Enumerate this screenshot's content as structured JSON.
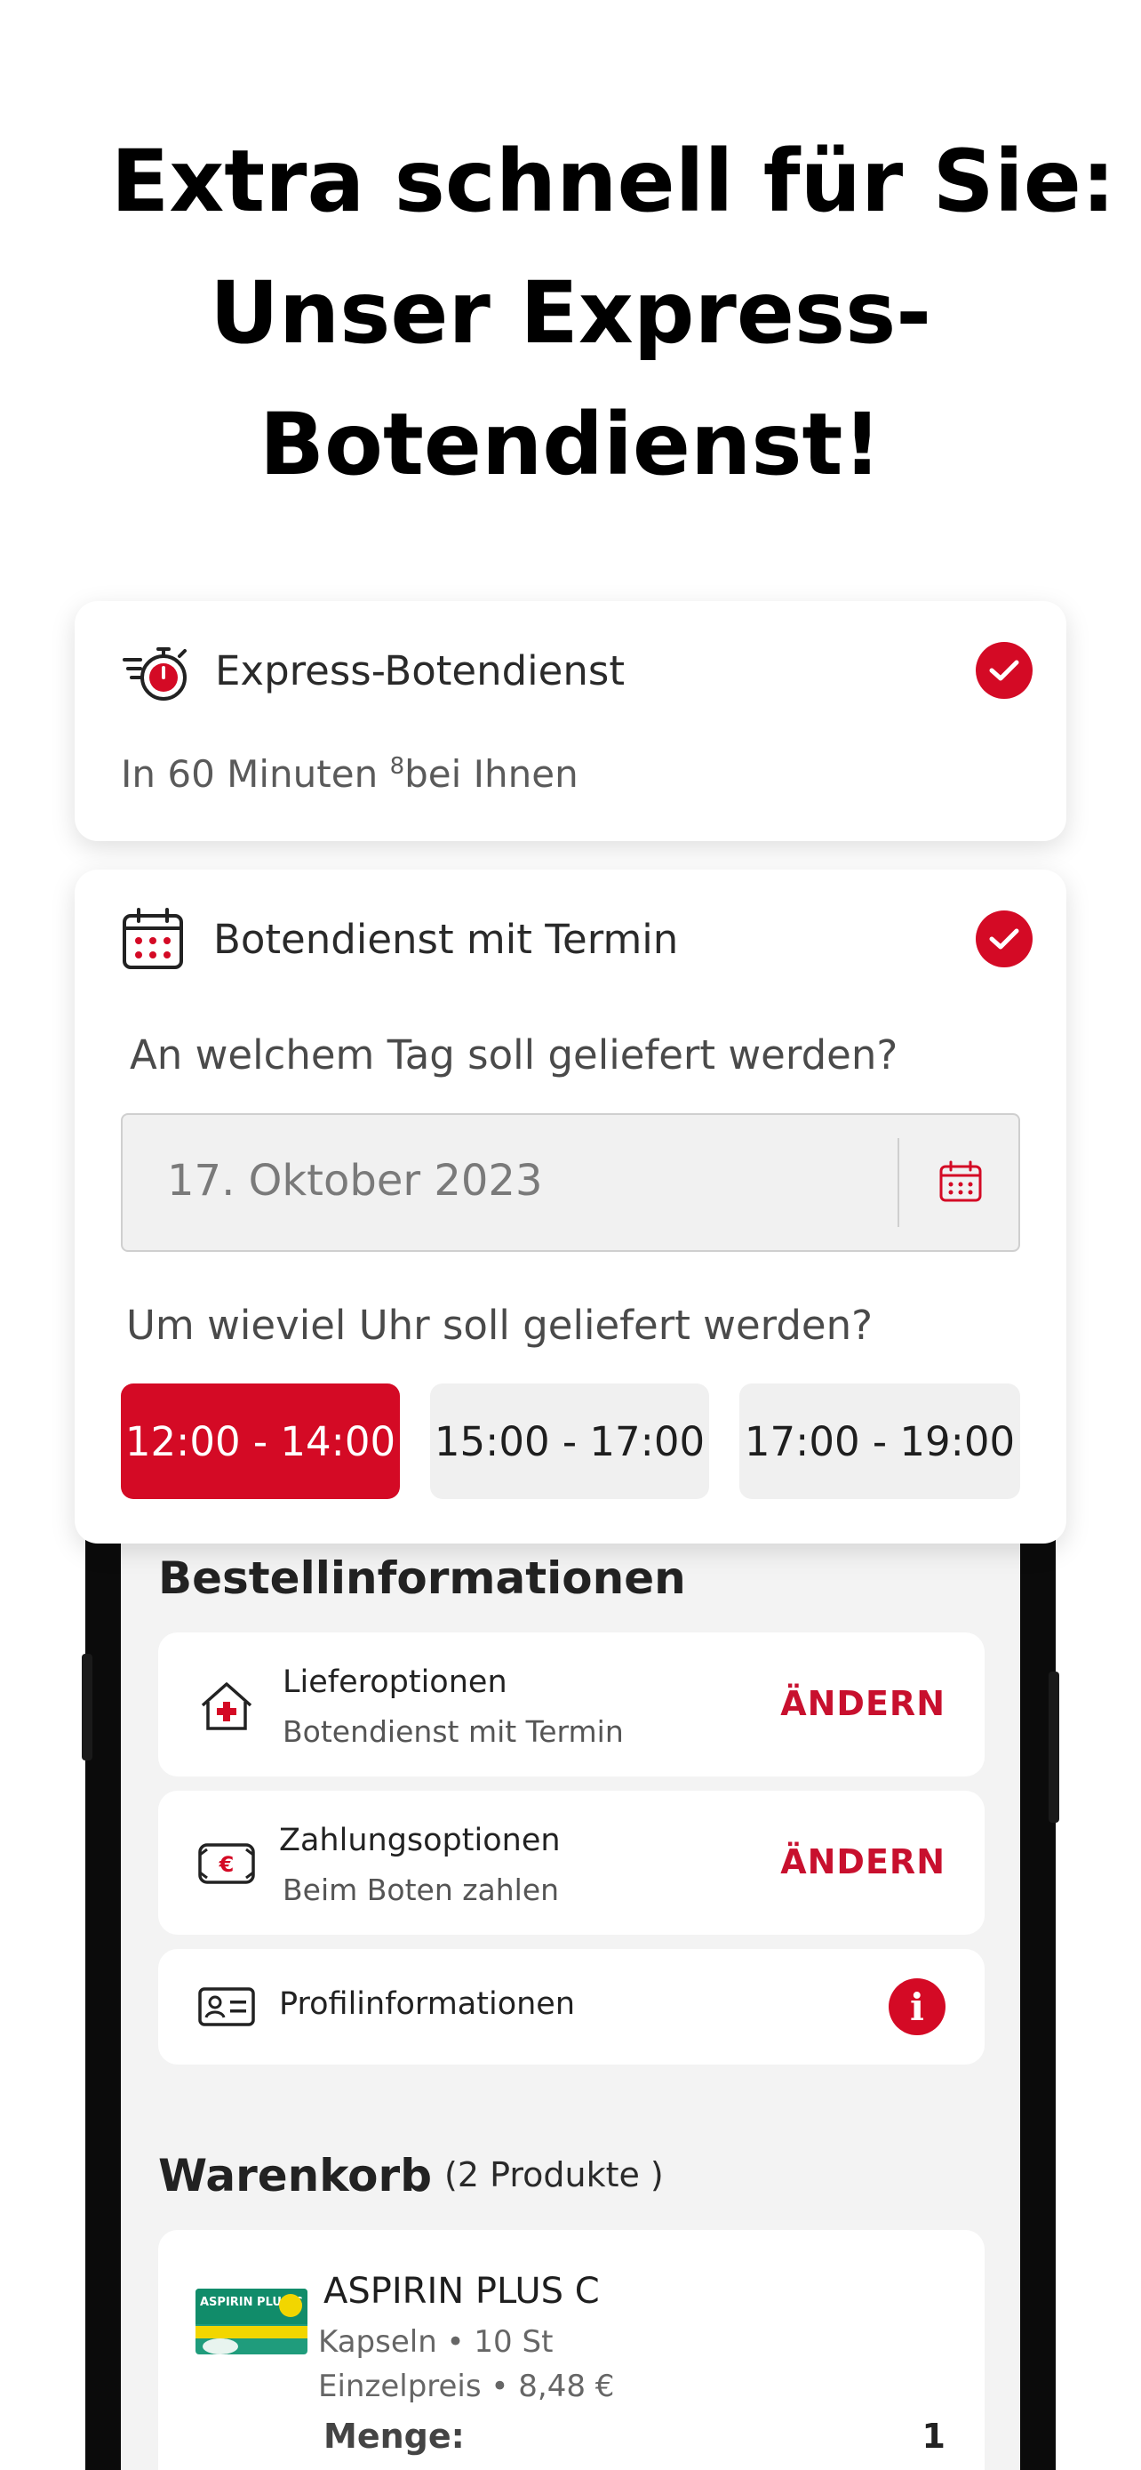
{
  "headline": {
    "line1": "Extra schnell für Sie:",
    "line2": "Unser Express-",
    "line3": "Botendienst!"
  },
  "express_card": {
    "title": "Express-Botendienst",
    "subtitle_before": "In 60 Minuten ",
    "superscript": "8",
    "subtitle_after": "bei Ihnen",
    "selected": true,
    "icon": "stopwatch-icon"
  },
  "appointment_card": {
    "title": "Botendienst mit Termin",
    "selected": true,
    "icon": "calendar-icon",
    "day_question": "An welchem Tag soll geliefert werden?",
    "date_value": "17. Oktober 2023",
    "time_question": "Um wieviel Uhr soll geliefert werden?",
    "slots": [
      {
        "label": "12:00 - 14:00",
        "active": true
      },
      {
        "label": "15:00 - 17:00",
        "active": false
      },
      {
        "label": "17:00 - 19:00",
        "active": false
      }
    ]
  },
  "order_info": {
    "title": "Bestellinformationen",
    "delivery": {
      "label": "Lieferoptionen",
      "value": "Botendienst mit Termin",
      "action": "ÄNDERN",
      "icon": "house-medical-icon"
    },
    "payment": {
      "label": "Zahlungsoptionen",
      "value": "Beim Boten zahlen",
      "action": "ÄNDERN",
      "icon": "euro-cash-icon"
    },
    "profile": {
      "label": "Profilinformationen",
      "icon": "id-card-icon",
      "status_icon": "info-icon"
    }
  },
  "cart": {
    "title": "Warenkorb",
    "count": "(2 Produkte )",
    "item": {
      "name": "ASPIRIN PLUS C",
      "form": "Kapseln • 10 St",
      "unit_price": "Einzelpreis • 8,48 €",
      "qty_label": "Menge:",
      "qty": "1",
      "image_label": "ASPIRIN PLUS C"
    }
  },
  "colors": {
    "accent": "#d40a25",
    "background": "#f3f3f3"
  }
}
